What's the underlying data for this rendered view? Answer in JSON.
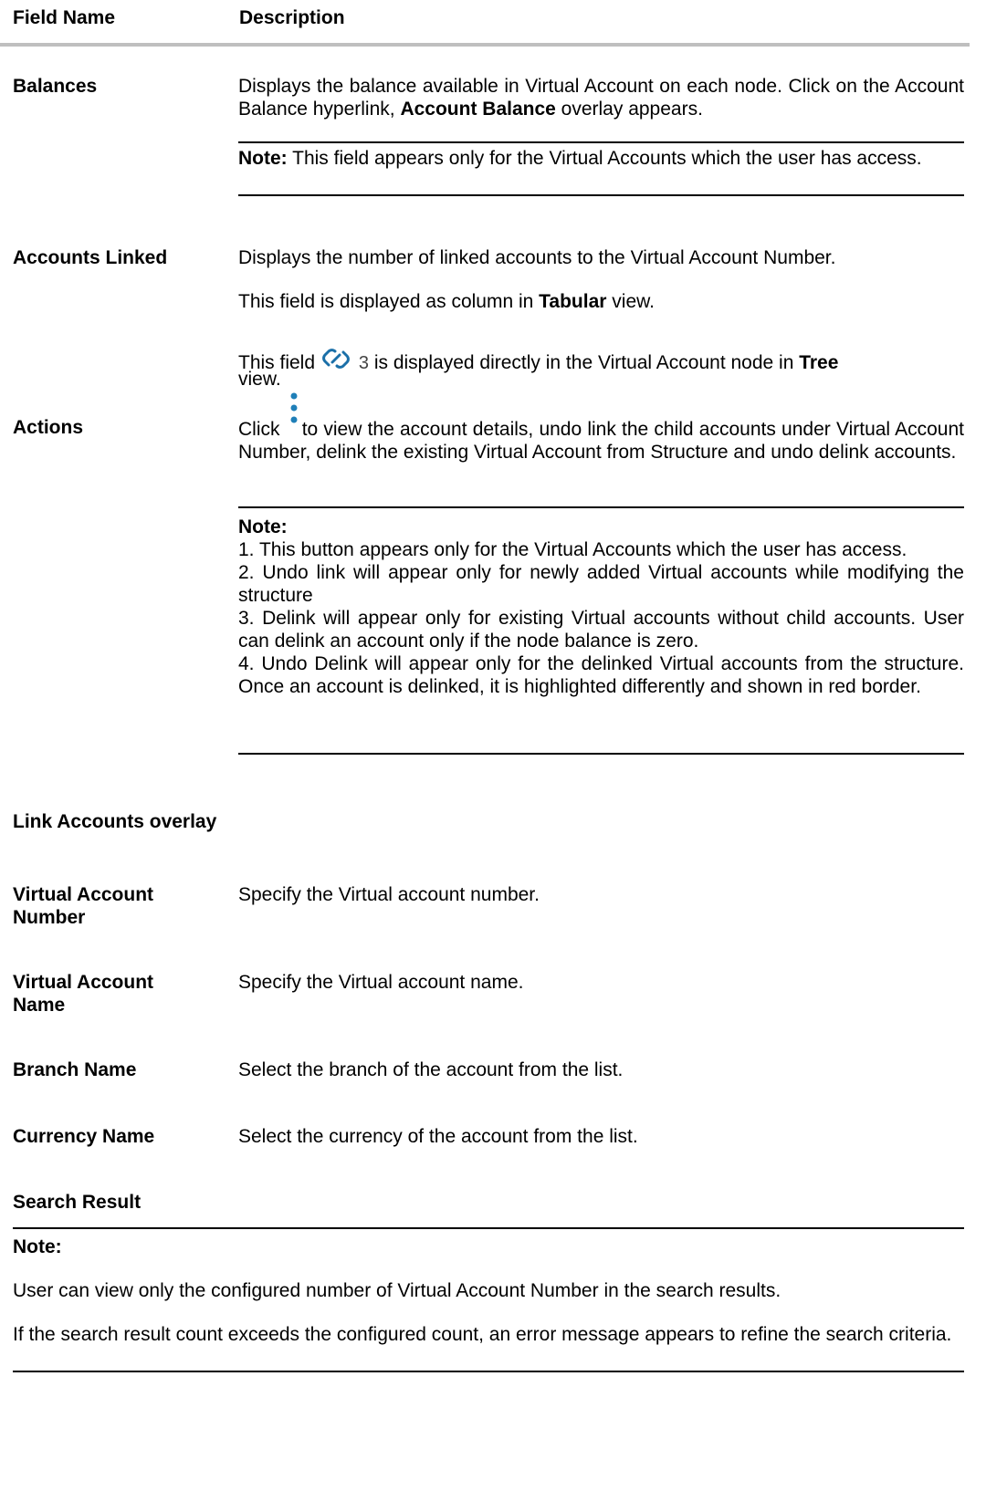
{
  "table": {
    "header": {
      "field": "Field Name",
      "description": "Description"
    },
    "balances": {
      "name": "Balances",
      "desc_part1": "Displays the balance available in Virtual Account on each node. Click on the Account Balance hyperlink, ",
      "desc_bold": "Account Balance",
      "desc_part2": " overlay appears.",
      "note_label": "Note:",
      "note_text": " This field appears only for the Virtual Accounts which the user has access."
    },
    "accounts_linked": {
      "name": "Accounts Linked",
      "line1": "Displays the number of linked accounts to the Virtual Account Number.",
      "line2_a": "This field is displayed as column in ",
      "line2_bold": "Tabular",
      "line2_b": " view.",
      "line3_a": "This field ",
      "icon_count": "3",
      "line3_b": " is displayed directly in the Virtual Account node in ",
      "line3_bold": "Tree",
      "line3_c": "view."
    },
    "actions": {
      "name": "Actions",
      "click_a": "Click",
      "click_b": " to view the account details, undo link the child accounts under Virtual Account Number, delink the existing Virtual Account from Structure and undo delink accounts.",
      "note_label": "Note:",
      "notes": [
        "1. This button appears only for the Virtual Accounts which the user has access.",
        "2. Undo link will appear only for newly added Virtual accounts while modifying the structure",
        "3. Delink will appear only for existing Virtual accounts without child accounts. User can delink an account only if the node balance is zero.",
        "4. Undo Delink will appear only for the delinked Virtual accounts from the structure. Once an account is delinked, it is highlighted differently and shown in red border."
      ]
    },
    "link_overlay": {
      "heading": "Link Accounts overlay"
    },
    "van": {
      "name_line1": "Virtual Account",
      "name_line2": "Number",
      "desc": "Specify the Virtual account number."
    },
    "vaname": {
      "name_line1": "Virtual Account",
      "name_line2": "Name",
      "desc": "Specify the Virtual account name."
    },
    "branch": {
      "name": "Branch Name",
      "desc": "Select the branch of the account from the list."
    },
    "currency": {
      "name": "Currency Name",
      "desc": "Select the currency of the account from the list."
    },
    "search": {
      "heading": "Search Result",
      "note_label": "Note:",
      "line1": "User can view only the configured number of Virtual Account Number in the search results.",
      "line2": "If the search result count exceeds the configured count, an error message appears to refine the search criteria."
    }
  },
  "colors": {
    "link_icon": "#1a6fa8",
    "header_rule": "#bfbfbf"
  },
  "icons": {
    "link": "link-icon",
    "kebab": "kebab-menu-icon"
  }
}
